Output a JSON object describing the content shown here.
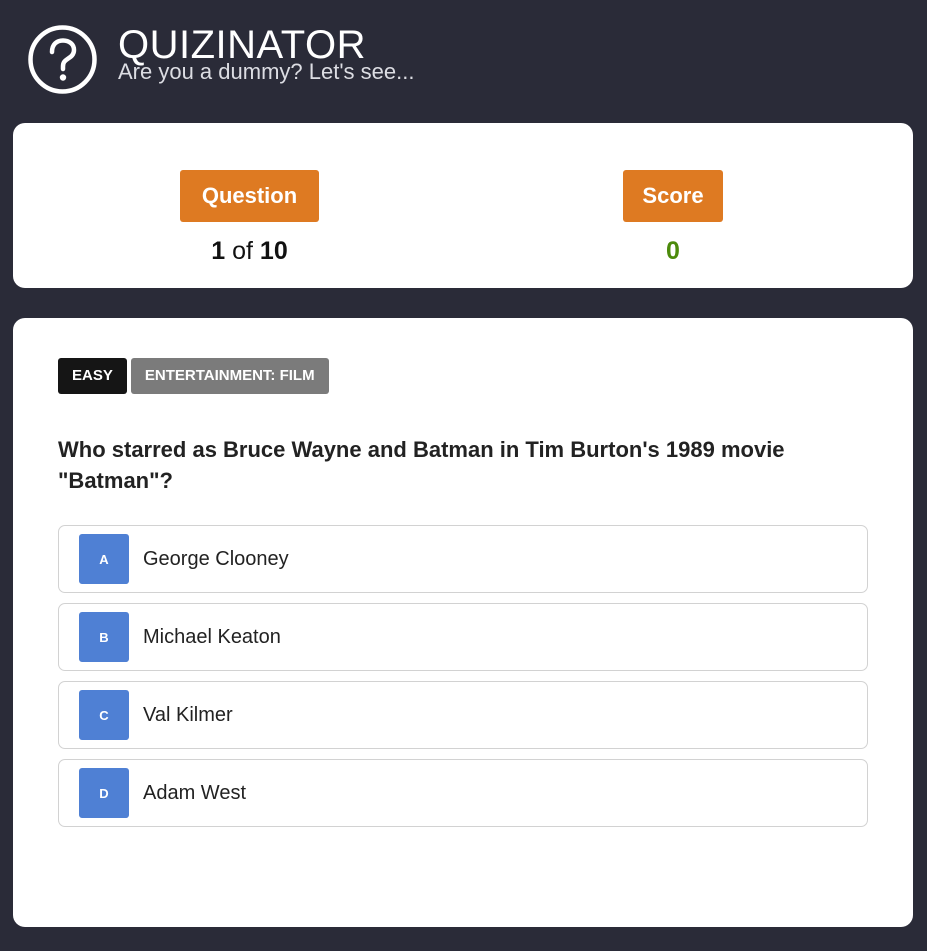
{
  "header": {
    "logo_icon": "question-circle-icon",
    "title": "QUIZINATOR",
    "subtitle": "Are you a dummy? Let's see..."
  },
  "stats": {
    "question_label": "Question",
    "question_current": "1",
    "question_of": "of",
    "question_total": "10",
    "score_label": "Score",
    "score_value": "0"
  },
  "quiz": {
    "difficulty": "EASY",
    "category": "ENTERTAINMENT: FILM",
    "question": "Who starred as Bruce Wayne and Batman in Tim Burton's 1989 movie \"Batman\"?",
    "answers": [
      {
        "letter": "A",
        "text": "George Clooney"
      },
      {
        "letter": "B",
        "text": "Michael Keaton"
      },
      {
        "letter": "C",
        "text": "Val Kilmer"
      },
      {
        "letter": "D",
        "text": "Adam West"
      }
    ]
  },
  "colors": {
    "background": "#2a2b38",
    "accent_orange": "#de7a22",
    "answer_letter_blue": "#4f80d4",
    "score_green": "#4c8a0b"
  }
}
